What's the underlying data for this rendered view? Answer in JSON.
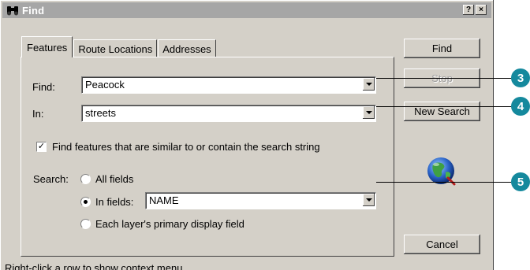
{
  "window": {
    "title": "Find",
    "help_label": "?",
    "close_label": "×"
  },
  "tabs": [
    {
      "label": "Features",
      "active": true
    },
    {
      "label": "Route Locations",
      "active": false
    },
    {
      "label": "Addresses",
      "active": false
    }
  ],
  "form": {
    "find_label": "Find:",
    "find_value": "Peacock",
    "in_label": "In:",
    "in_value": "streets",
    "similar_checkbox_label": "Find features that are similar to or contain the search string",
    "similar_checked": true,
    "search_label": "Search:",
    "radio_all_fields": "All fields",
    "radio_in_fields": "In fields:",
    "in_fields_value": "NAME",
    "radio_primary_display": "Each layer's primary display field",
    "selected_radio": "in_fields"
  },
  "buttons": {
    "find": "Find",
    "stop": "Stop",
    "new_search": "New Search",
    "cancel": "Cancel"
  },
  "status_text": "Right-click a row to show context menu",
  "callouts": [
    "3",
    "4",
    "5"
  ],
  "colors": {
    "callout": "#15899d",
    "titlebar": "#a6a6a6",
    "dialog": "#d4d0c8"
  },
  "icons": {
    "title": "binoculars-icon",
    "globe": "globe-find-icon"
  }
}
